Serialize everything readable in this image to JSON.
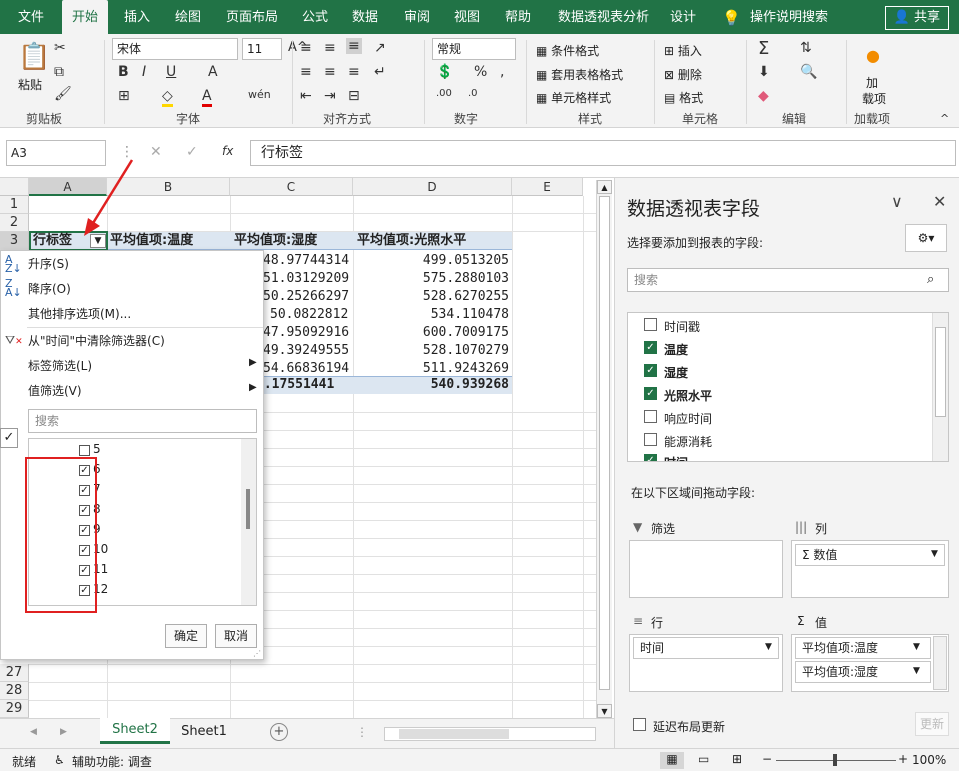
{
  "ribbon_tabs": [
    "文件",
    "开始",
    "插入",
    "绘图",
    "页面布局",
    "公式",
    "数据",
    "审阅",
    "视图",
    "帮助",
    "数据透视表分析",
    "设计"
  ],
  "tell_me": "操作说明搜索",
  "share": "共享",
  "groups": {
    "clipboard": {
      "label": "剪贴板",
      "paste": "粘贴"
    },
    "font": {
      "label": "字体",
      "name": "宋体",
      "size": "11"
    },
    "align": {
      "label": "对齐方式"
    },
    "number": {
      "label": "数字",
      "format": "常规"
    },
    "styles": {
      "label": "样式",
      "cond": "条件格式",
      "table": "套用表格格式",
      "cell": "单元格样式"
    },
    "cells": {
      "label": "单元格",
      "insert": "插入",
      "delete": "删除",
      "format": "格式"
    },
    "editing": {
      "label": "编辑"
    },
    "addins": {
      "label": "加载项",
      "btn1": "加",
      "btn2": "载项"
    }
  },
  "formula_bar": {
    "name_box": "A3",
    "fx": "fx",
    "content": "行标签"
  },
  "columns": [
    "A",
    "B",
    "C",
    "D",
    "E"
  ],
  "rows_top": [
    "1",
    "2",
    "3"
  ],
  "rows_bottom": [
    "27",
    "28",
    "29"
  ],
  "header_row": [
    "行标签",
    "平均值项:温度",
    "平均值项:湿度",
    "平均值项:光照水平"
  ],
  "table": {
    "c_col": [
      "48.97744314",
      "51.03129209",
      "50.25266297",
      "50.0822812",
      "47.95092916",
      "49.39249555",
      "54.66836194"
    ],
    "d_col": [
      "499.0513205",
      "575.2880103",
      "528.6270255",
      "534.110478",
      "600.7009175",
      "528.1070279",
      "511.9243269"
    ],
    "total_c": "0.17551441",
    "total_d": "540.939268"
  },
  "filter_menu": {
    "sort_asc": "升序(S)",
    "sort_desc": "降序(O)",
    "more_sort": "其他排序选项(M)...",
    "clear": "从\"时间\"中清除筛选器(C)",
    "label_filter": "标签筛选(L)",
    "value_filter": "值筛选(V)",
    "search_placeholder": "搜索",
    "items": [
      {
        "label": "5",
        "checked": false
      },
      {
        "label": "6",
        "checked": true
      },
      {
        "label": "7",
        "checked": true
      },
      {
        "label": "8",
        "checked": true
      },
      {
        "label": "9",
        "checked": true
      },
      {
        "label": "10",
        "checked": true
      },
      {
        "label": "11",
        "checked": true
      },
      {
        "label": "12",
        "checked": true
      }
    ],
    "ok": "确定",
    "cancel": "取消"
  },
  "pivot_pane": {
    "title": "数据透视表字段",
    "subtitle": "选择要添加到报表的字段:",
    "search_placeholder": "搜索",
    "fields": [
      {
        "label": "时间戳",
        "checked": false
      },
      {
        "label": "温度",
        "checked": true
      },
      {
        "label": "湿度",
        "checked": true
      },
      {
        "label": "光照水平",
        "checked": true
      },
      {
        "label": "响应时间",
        "checked": false
      },
      {
        "label": "能源消耗",
        "checked": false
      },
      {
        "label": "时间",
        "checked": true
      }
    ],
    "drag_label": "在以下区域间拖动字段:",
    "filter_area": "筛选",
    "column_area": "列",
    "column_item": "Σ 数值",
    "row_area": "行",
    "row_item": "时间",
    "value_area": "值",
    "value_items": [
      "平均值项:温度",
      "平均值项:湿度"
    ],
    "defer": "延迟布局更新",
    "update": "更新"
  },
  "sheets": [
    "Sheet2",
    "Sheet1"
  ],
  "status": {
    "ready": "就绪",
    "accessibility": "辅助功能: 调查",
    "zoom": "100%"
  },
  "colors": {
    "accent": "#217346",
    "highlight": "#dce6f1",
    "callout": "#e02020"
  }
}
